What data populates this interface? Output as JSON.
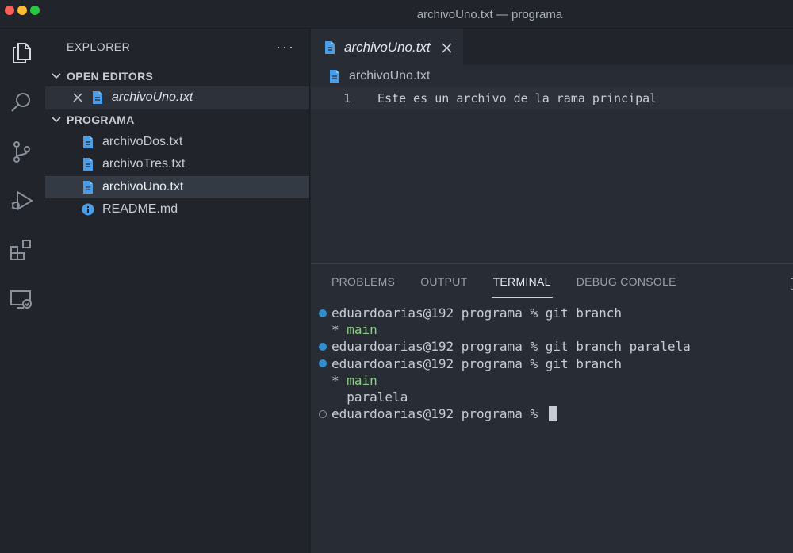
{
  "window": {
    "title": "archivoUno.txt — programa"
  },
  "activity_bar": {
    "icons": [
      "explorer-icon",
      "search-icon",
      "source-control-icon",
      "run-debug-icon",
      "extensions-icon",
      "remote-explorer-icon"
    ]
  },
  "sidebar": {
    "title": "EXPLORER",
    "more_label": "···",
    "open_editors": {
      "label": "OPEN EDITORS",
      "items": [
        {
          "name": "archivoUno.txt"
        }
      ]
    },
    "folder": {
      "label": "PROGRAMA",
      "files": [
        {
          "name": "archivoDos.txt",
          "icon": "file-icon"
        },
        {
          "name": "archivoTres.txt",
          "icon": "file-icon"
        },
        {
          "name": "archivoUno.txt",
          "icon": "file-icon",
          "active": true
        },
        {
          "name": "README.md",
          "icon": "info-icon"
        }
      ]
    }
  },
  "editor": {
    "tab": {
      "label": "archivoUno.txt"
    },
    "breadcrumb": "archivoUno.txt",
    "lines": [
      {
        "number": "1",
        "text": "Este es un archivo de la rama principal"
      }
    ]
  },
  "panel": {
    "tabs": [
      "PROBLEMS",
      "OUTPUT",
      "TERMINAL",
      "DEBUG CONSOLE"
    ],
    "active_tab": "TERMINAL",
    "terminal": {
      "prompt": "eduardoarias@192 programa % ",
      "lines": [
        {
          "cmd": "git branch"
        },
        {
          "out": "* ",
          "highlight": "main"
        },
        {
          "cmd": "git branch paralela"
        },
        {
          "cmd": "git branch"
        },
        {
          "out": "* ",
          "highlight": "main"
        },
        {
          "out": "  paralela"
        },
        {
          "cmd": ""
        }
      ]
    }
  },
  "colors": {
    "accent_blue": "#2e8fd0",
    "branch_green": "#8ed08a",
    "background": "#282c34"
  }
}
